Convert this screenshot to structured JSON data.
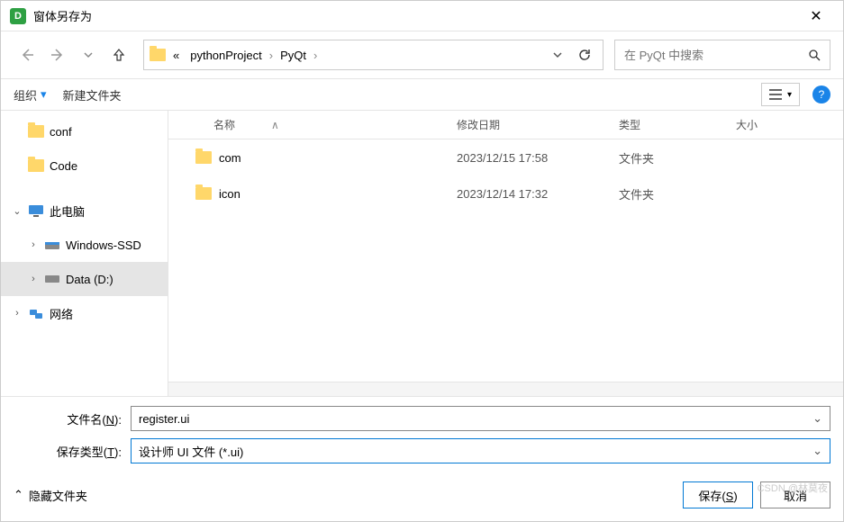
{
  "window": {
    "title": "窗体另存为"
  },
  "path": {
    "segments": [
      "pythonProject",
      "PyQt"
    ],
    "prefix": "«"
  },
  "search": {
    "placeholder": "在 PyQt 中搜索"
  },
  "toolbar": {
    "organize": "组织",
    "new_folder": "新建文件夹"
  },
  "columns": {
    "name": "名称",
    "date": "修改日期",
    "type": "类型",
    "size": "大小"
  },
  "tree": {
    "conf": "conf",
    "code": "Code",
    "this_pc": "此电脑",
    "win_ssd": "Windows-SSD",
    "data_d": "Data (D:)",
    "network": "网络"
  },
  "files": [
    {
      "name": "com",
      "date": "2023/12/15 17:58",
      "type": "文件夹"
    },
    {
      "name": "icon",
      "date": "2023/12/14 17:32",
      "type": "文件夹"
    }
  ],
  "form": {
    "filename_label_pre": "文件名(",
    "filename_label_u": "N",
    "filename_label_post": "):",
    "filename_value": "register.ui",
    "type_label_pre": "保存类型(",
    "type_label_u": "T",
    "type_label_post": "):",
    "type_value": "设计师 UI 文件 (*.ui)"
  },
  "footer": {
    "hide_folders": "隐藏文件夹",
    "save_pre": "保存(",
    "save_u": "S",
    "save_post": ")",
    "cancel": "取消"
  },
  "watermark": "CSDN @林莫夜"
}
